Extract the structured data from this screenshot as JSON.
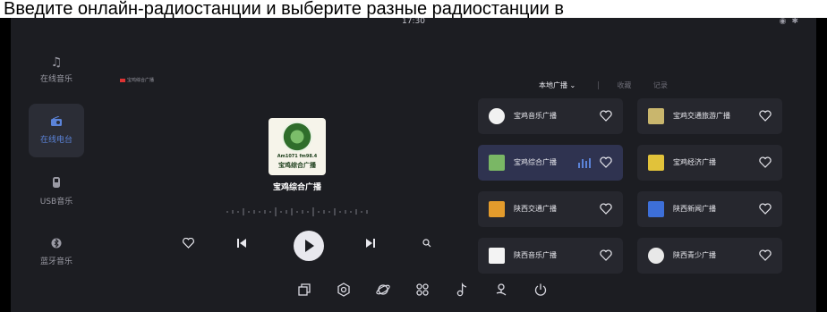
{
  "caption": "Введите онлайн-радиостанции и выберите разные радиостанции в",
  "status": {
    "time": "17:30",
    "icons": [
      "eye-icon",
      "bluetooth-icon"
    ]
  },
  "sidebar": {
    "items": [
      {
        "label": "在线音乐",
        "icon": "music-note-icon",
        "active": false
      },
      {
        "label": "在线电台",
        "icon": "radio-icon",
        "active": true
      },
      {
        "label": "USB音乐",
        "icon": "usb-icon",
        "active": false
      },
      {
        "label": "蓝牙音乐",
        "icon": "bluetooth-icon",
        "active": false
      }
    ]
  },
  "now_playing": {
    "source_tag": "宝鸡综合广播",
    "cover_freq": "Am1071 fm98.4",
    "cover_name": "宝鸡综合广播",
    "title": "宝鸡综合广播"
  },
  "controls": [
    "heart-icon",
    "previous-icon",
    "play-icon",
    "next-icon",
    "search-icon"
  ],
  "tabs": {
    "local": "本地广播",
    "favorites": "收藏",
    "history": "记录"
  },
  "stations": [
    {
      "name": "宝鸡音乐广播",
      "logo_color": "#f1f1f1",
      "playing": false
    },
    {
      "name": "宝鸡交通旅游广播",
      "logo_color": "#c9b66d",
      "playing": false
    },
    {
      "name": "宝鸡综合广播",
      "logo_color": "#7ab765",
      "playing": true
    },
    {
      "name": "宝鸡经济广播",
      "logo_color": "#e1c23a",
      "playing": false
    },
    {
      "name": "陕西交通广播",
      "logo_color": "#e39b2c",
      "playing": false
    },
    {
      "name": "陕西新闻广播",
      "logo_color": "#3d6fd8",
      "playing": false
    },
    {
      "name": "陕西音乐广播",
      "logo_color": "#f3f3f3",
      "playing": false
    },
    {
      "name": "陕西青少广播",
      "logo_color": "#e8e8e8",
      "playing": false
    }
  ],
  "dock": [
    "windows-icon",
    "settings-icon",
    "planet-icon",
    "apps-grid-icon",
    "music-icon",
    "navigation-icon",
    "power-icon"
  ],
  "colors": {
    "accent": "#5b83d8",
    "background": "#1c1d22",
    "card": "#26272e",
    "card_playing": "#2f3350"
  }
}
